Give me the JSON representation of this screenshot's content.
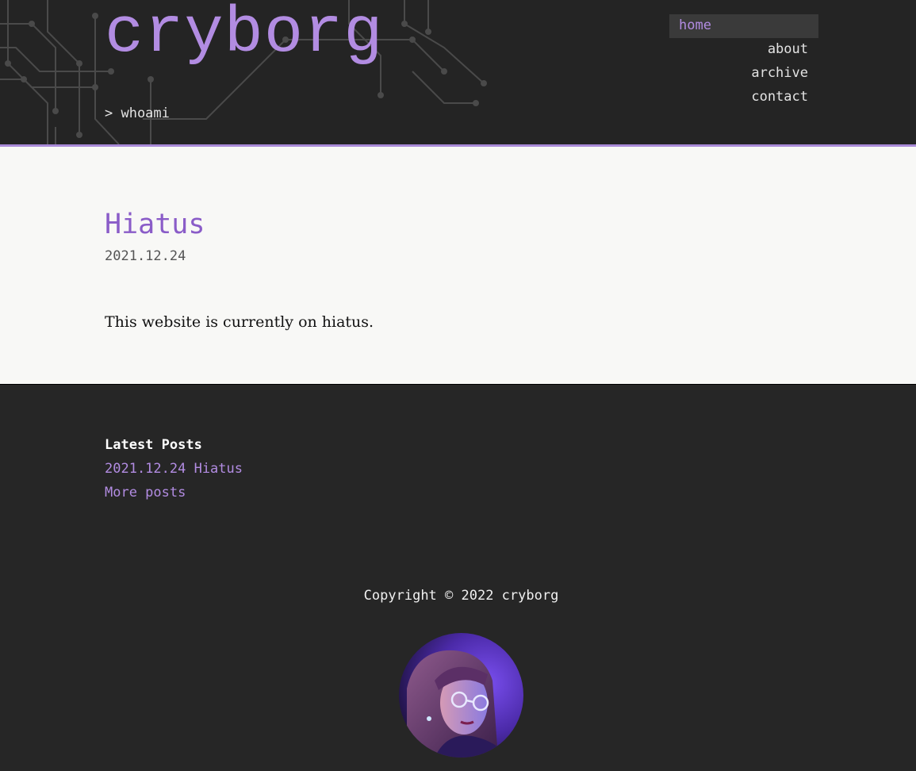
{
  "site": {
    "title": "cryborg",
    "tagline": "> whoami"
  },
  "nav": {
    "items": [
      {
        "label": "home",
        "active": true
      },
      {
        "label": "about",
        "active": false
      },
      {
        "label": "archive",
        "active": false
      },
      {
        "label": "contact",
        "active": false
      }
    ]
  },
  "post": {
    "title": "Hiatus",
    "date": "2021.12.24",
    "body": "This website is currently on hiatus."
  },
  "footer": {
    "latest_heading": "Latest Posts",
    "latest_posts": [
      {
        "label": "2021.12.24 Hiatus"
      }
    ],
    "more_posts": "More posts",
    "copyright": "Copyright © 2022 cryborg"
  },
  "colors": {
    "accent": "#b28ce2",
    "post_title": "#8a5cc8",
    "header_bg": "#242424",
    "content_bg": "#f8f8f6",
    "footer_bg": "#262626"
  },
  "icons": {
    "avatar": "avatar-portrait"
  }
}
